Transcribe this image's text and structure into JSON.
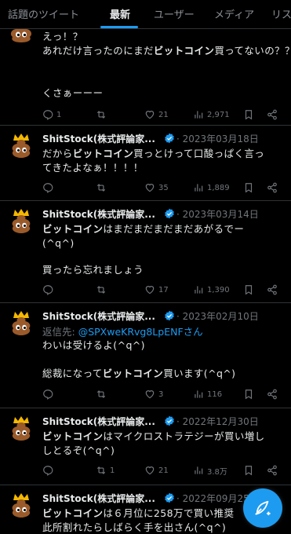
{
  "tabs": [
    {
      "label": "話題のツイート"
    },
    {
      "label": "最新"
    },
    {
      "label": "ユーザー"
    },
    {
      "label": "メディア"
    },
    {
      "label": "リス"
    }
  ],
  "colors": {
    "accent": "#1d9bf0",
    "muted": "#71767b",
    "text": "#e7e9ea",
    "background": "#000000"
  },
  "tweets": [
    {
      "lines": [
        "えっ！？",
        "あれだけ言ったのにまだビットコイン買ってないの？？",
        "",
        "くさぁーーー"
      ],
      "stats": {
        "replies": "1",
        "retweets": "",
        "likes": "21",
        "views": "2,971"
      }
    },
    {
      "name": "ShitStock(株式評論家...",
      "date": "· 2023年03月18日",
      "more": "···",
      "lines": [
        "だからビットコイン買っとけって口酸っぱく言ってきたよなぁ！！！！"
      ],
      "line_display": [
        "だからビットコイン買っとけって口酸っぱく言っ",
        "てきたよなぁ！！！！"
      ],
      "stats": {
        "replies": "",
        "retweets": "",
        "likes": "35",
        "views": "1,889"
      }
    },
    {
      "name": "ShitStock(株式評論家...",
      "date": "· 2023年03月14日",
      "more": "···",
      "lines": [
        "ビットコインはまだまだまだまだあがるでー(^q^)",
        "",
        "買ったら忘れましょう"
      ],
      "line_display": [
        "ビットコインはまだまだまだまだあがるでー",
        "(^q^)",
        "",
        "買ったら忘れましょう"
      ],
      "stats": {
        "replies": "",
        "retweets": "",
        "likes": "17",
        "views": "1,390"
      }
    },
    {
      "name": "ShitStock(株式評論家...",
      "date": "· 2023年02月10日",
      "more": "···",
      "reply_prefix": "返信先: ",
      "reply_handle": "@SPXweKRvg8LpENFさん",
      "lines": [
        "わいは受けるよ(^q^)",
        "",
        "総裁になってビットコイン買います(^q^)"
      ],
      "stats": {
        "replies": "",
        "retweets": "",
        "likes": "3",
        "views": "116"
      }
    },
    {
      "name": "ShitStock(株式評論家...",
      "date": "· 2022年12月30日",
      "more": "···",
      "lines": [
        "ビットコインはマイクロストラテジーが買い増ししとるぞ(^q^)"
      ],
      "line_display": [
        "ビットコインはマイクロストラテジーが買い増し",
        "しとるぞ(^q^)"
      ],
      "stats": {
        "replies": "",
        "retweets": "1",
        "likes": "21",
        "views": "3.8万"
      }
    },
    {
      "name": "ShitStock(株式評論家...",
      "date": "· 2022年09月25日",
      "more": "···",
      "lines": [
        "ビットコインは６月位に258万で買い推奨",
        "此所割れたらしばらく手を出さん(^q^)"
      ],
      "stats": {
        "replies": "",
        "retweets": "",
        "likes": "",
        "views": ""
      }
    }
  ],
  "fab": {
    "icon": "compose-tweet-icon"
  }
}
